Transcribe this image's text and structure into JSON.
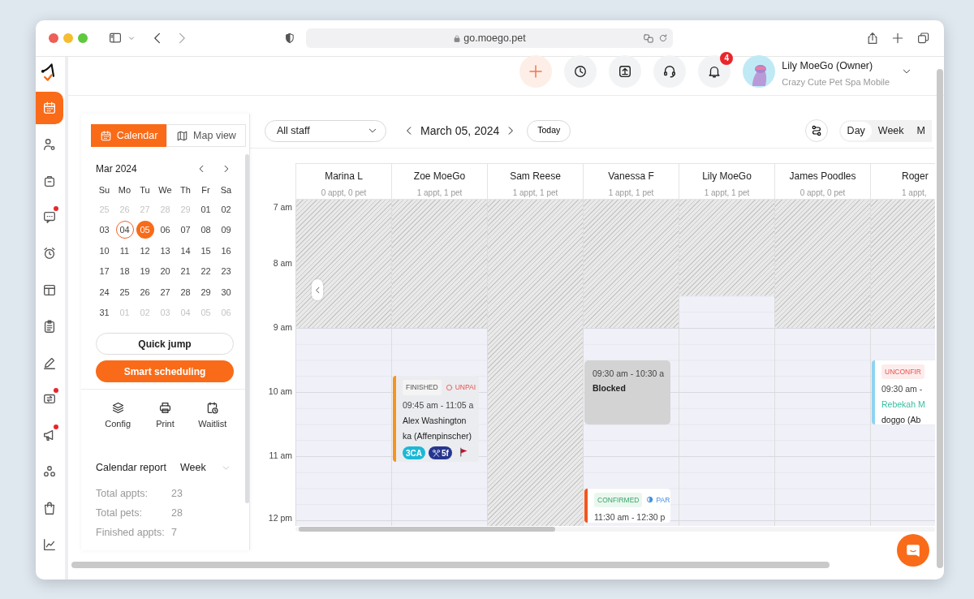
{
  "browser": {
    "url": "go.moego.pet"
  },
  "nav_items": [
    {
      "kind": "calendar",
      "selected": true,
      "dot": false
    },
    {
      "kind": "clients",
      "selected": false,
      "dot": false
    },
    {
      "kind": "briefcase",
      "selected": false,
      "dot": false
    },
    {
      "kind": "chat",
      "selected": false,
      "dot": true
    },
    {
      "kind": "alarm",
      "selected": false,
      "dot": false
    },
    {
      "kind": "layout",
      "selected": false,
      "dot": false
    },
    {
      "kind": "clipboard",
      "selected": false,
      "dot": false
    },
    {
      "kind": "pencil",
      "selected": false,
      "dot": false
    },
    {
      "kind": "swap",
      "selected": false,
      "dot": true
    },
    {
      "kind": "megaphone",
      "selected": false,
      "dot": true
    },
    {
      "kind": "shapes",
      "selected": false,
      "dot": false
    },
    {
      "kind": "bag",
      "selected": false,
      "dot": false
    },
    {
      "kind": "chart",
      "selected": false,
      "dot": false
    }
  ],
  "header": {
    "actions": [
      {
        "kind": "add"
      },
      {
        "kind": "clock"
      },
      {
        "kind": "upload"
      },
      {
        "kind": "headset"
      },
      {
        "kind": "bell",
        "badge": "4"
      }
    ],
    "user": {
      "name": "Lily MoeGo (Owner)",
      "business": "Crazy Cute Pet Spa Mobile"
    }
  },
  "view_toggle": [
    {
      "kind": "calendar",
      "label": "Calendar",
      "selected": true
    },
    {
      "kind": "map",
      "label": "Map view",
      "selected": false
    }
  ],
  "toolbar": {
    "staff_filter": "All staff",
    "date": "March 05, 2024",
    "today_button": "Today",
    "view_modes": [
      {
        "label": "Day",
        "selected": true
      },
      {
        "label": "Week",
        "selected": false
      },
      {
        "label": "M",
        "selected": false
      }
    ]
  },
  "mini_calendar": {
    "month": "Mar 2024",
    "weekdays": [
      "Su",
      "Mo",
      "Tu",
      "We",
      "Th",
      "Fr",
      "Sa"
    ],
    "days": [
      {
        "label": "25",
        "muted": true,
        "today": false,
        "selected": false
      },
      {
        "label": "26",
        "muted": true,
        "today": false,
        "selected": false
      },
      {
        "label": "27",
        "muted": true,
        "today": false,
        "selected": false
      },
      {
        "label": "28",
        "muted": true,
        "today": false,
        "selected": false
      },
      {
        "label": "29",
        "muted": true,
        "today": false,
        "selected": false
      },
      {
        "label": "01",
        "muted": false,
        "today": false,
        "selected": false
      },
      {
        "label": "02",
        "muted": false,
        "today": false,
        "selected": false
      },
      {
        "label": "03",
        "muted": false,
        "today": false,
        "selected": false
      },
      {
        "label": "04",
        "muted": false,
        "today": true,
        "selected": false
      },
      {
        "label": "05",
        "muted": false,
        "today": false,
        "selected": true
      },
      {
        "label": "06",
        "muted": false,
        "today": false,
        "selected": false
      },
      {
        "label": "07",
        "muted": false,
        "today": false,
        "selected": false
      },
      {
        "label": "08",
        "muted": false,
        "today": false,
        "selected": false
      },
      {
        "label": "09",
        "muted": false,
        "today": false,
        "selected": false
      },
      {
        "label": "10",
        "muted": false,
        "today": false,
        "selected": false
      },
      {
        "label": "11",
        "muted": false,
        "today": false,
        "selected": false
      },
      {
        "label": "12",
        "muted": false,
        "today": false,
        "selected": false
      },
      {
        "label": "13",
        "muted": false,
        "today": false,
        "selected": false
      },
      {
        "label": "14",
        "muted": false,
        "today": false,
        "selected": false
      },
      {
        "label": "15",
        "muted": false,
        "today": false,
        "selected": false
      },
      {
        "label": "16",
        "muted": false,
        "today": false,
        "selected": false
      },
      {
        "label": "17",
        "muted": false,
        "today": false,
        "selected": false
      },
      {
        "label": "18",
        "muted": false,
        "today": false,
        "selected": false
      },
      {
        "label": "19",
        "muted": false,
        "today": false,
        "selected": false
      },
      {
        "label": "20",
        "muted": false,
        "today": false,
        "selected": false
      },
      {
        "label": "21",
        "muted": false,
        "today": false,
        "selected": false
      },
      {
        "label": "22",
        "muted": false,
        "today": false,
        "selected": false
      },
      {
        "label": "23",
        "muted": false,
        "today": false,
        "selected": false
      },
      {
        "label": "24",
        "muted": false,
        "today": false,
        "selected": false
      },
      {
        "label": "25",
        "muted": false,
        "today": false,
        "selected": false
      },
      {
        "label": "26",
        "muted": false,
        "today": false,
        "selected": false
      },
      {
        "label": "27",
        "muted": false,
        "today": false,
        "selected": false
      },
      {
        "label": "28",
        "muted": false,
        "today": false,
        "selected": false
      },
      {
        "label": "29",
        "muted": false,
        "today": false,
        "selected": false
      },
      {
        "label": "30",
        "muted": false,
        "today": false,
        "selected": false
      },
      {
        "label": "31",
        "muted": false,
        "today": false,
        "selected": false
      },
      {
        "label": "01",
        "muted": true,
        "today": false,
        "selected": false
      },
      {
        "label": "02",
        "muted": true,
        "today": false,
        "selected": false
      },
      {
        "label": "03",
        "muted": true,
        "today": false,
        "selected": false
      },
      {
        "label": "04",
        "muted": true,
        "today": false,
        "selected": false
      },
      {
        "label": "05",
        "muted": true,
        "today": false,
        "selected": false
      },
      {
        "label": "06",
        "muted": true,
        "today": false,
        "selected": false
      }
    ]
  },
  "quick_jump": "Quick jump",
  "smart_scheduling": "Smart scheduling",
  "tools": [
    {
      "kind": "config",
      "label": "Config"
    },
    {
      "kind": "print",
      "label": "Print"
    },
    {
      "kind": "waitlist",
      "label": "Waitlist"
    }
  ],
  "report": {
    "title": "Calendar report",
    "period": "Week",
    "rows": [
      {
        "label": "Total appts:",
        "value": "23"
      },
      {
        "label": "Total pets:",
        "value": "28"
      },
      {
        "label": "Finished appts:",
        "value": "7"
      }
    ]
  },
  "calendar": {
    "hours": [
      "7 am",
      "8 am",
      "9 am",
      "10 am",
      "11 am",
      "12 pm"
    ],
    "staff": [
      {
        "name": "Marina L",
        "summary": "0 appt, 0 pet",
        "kind": "starts_9am"
      },
      {
        "name": "Zoe MoeGo",
        "summary": "1 appt, 1 pet",
        "kind": "starts_9am",
        "events": [
          {
            "kind": "appointment",
            "color": "#f7941d",
            "status": {
              "kind": "finished",
              "label": "FINISHED"
            },
            "payment": {
              "kind": "unpaid",
              "label": "UNPAI"
            },
            "time": "09:45 am - 11:05 a",
            "client": "Alex Washington",
            "pet": "ka (Affenpinscher)",
            "tags": [
              {
                "kind": "text",
                "label": "3CA",
                "color": "#1cb8d6"
              },
              {
                "kind": "scissors",
                "label": "5f",
                "color": "#26368f"
              },
              {
                "kind": "flag",
                "color": "#c8102e"
              }
            ]
          }
        ]
      },
      {
        "name": "Sam Reese",
        "summary": "1 appt, 1 pet",
        "kind": "day_off"
      },
      {
        "name": "Vanessa F",
        "summary": "1 appt, 1 pet",
        "kind": "starts_9am",
        "events": [
          {
            "kind": "blocked",
            "time": "09:30 am - 10:30 a",
            "title": "Blocked"
          },
          {
            "kind": "appointment",
            "color": "#f0581c",
            "status": {
              "kind": "confirmed",
              "label": "CONFIRMED"
            },
            "payment": {
              "kind": "partial",
              "label": "PAR"
            },
            "time": "11:30 am - 12:30 p"
          }
        ]
      },
      {
        "name": "Lily MoeGo",
        "summary": "1 appt, 1 pet",
        "kind": "starts_830am"
      },
      {
        "name": "James Poodles",
        "summary": "0 appt, 0 pet",
        "kind": "starts_9am"
      },
      {
        "name": "Roger",
        "summary": "1 appt,",
        "kind": "starts_9am",
        "events": [
          {
            "kind": "appointment",
            "color": "#8ed3f2",
            "status": {
              "kind": "unconfirmed",
              "label": "UNCONFIR"
            },
            "time": "09:30 am -",
            "client": "Rebekah M",
            "pet": "doggo (Ab"
          }
        ]
      }
    ]
  }
}
